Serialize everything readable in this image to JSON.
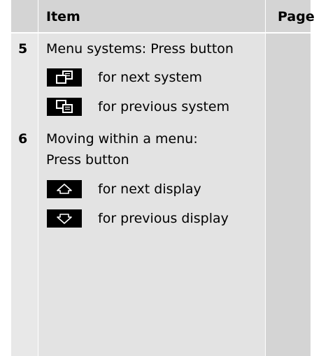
{
  "header": {
    "item": "Item",
    "page": "Page"
  },
  "rows": [
    {
      "number": "5",
      "text": "Menu systems: Press button"
    },
    {
      "number": "6",
      "text_line1": "Moving within a menu:",
      "text_line2": "Press button"
    }
  ],
  "buttons": [
    {
      "icon": "next-system-icon",
      "label": "for next system"
    },
    {
      "icon": "previous-system-icon",
      "label": "for previous system"
    },
    {
      "icon": "up-arrow-icon",
      "label": "for next display"
    },
    {
      "icon": "down-arrow-icon",
      "label": "for previous display"
    }
  ]
}
